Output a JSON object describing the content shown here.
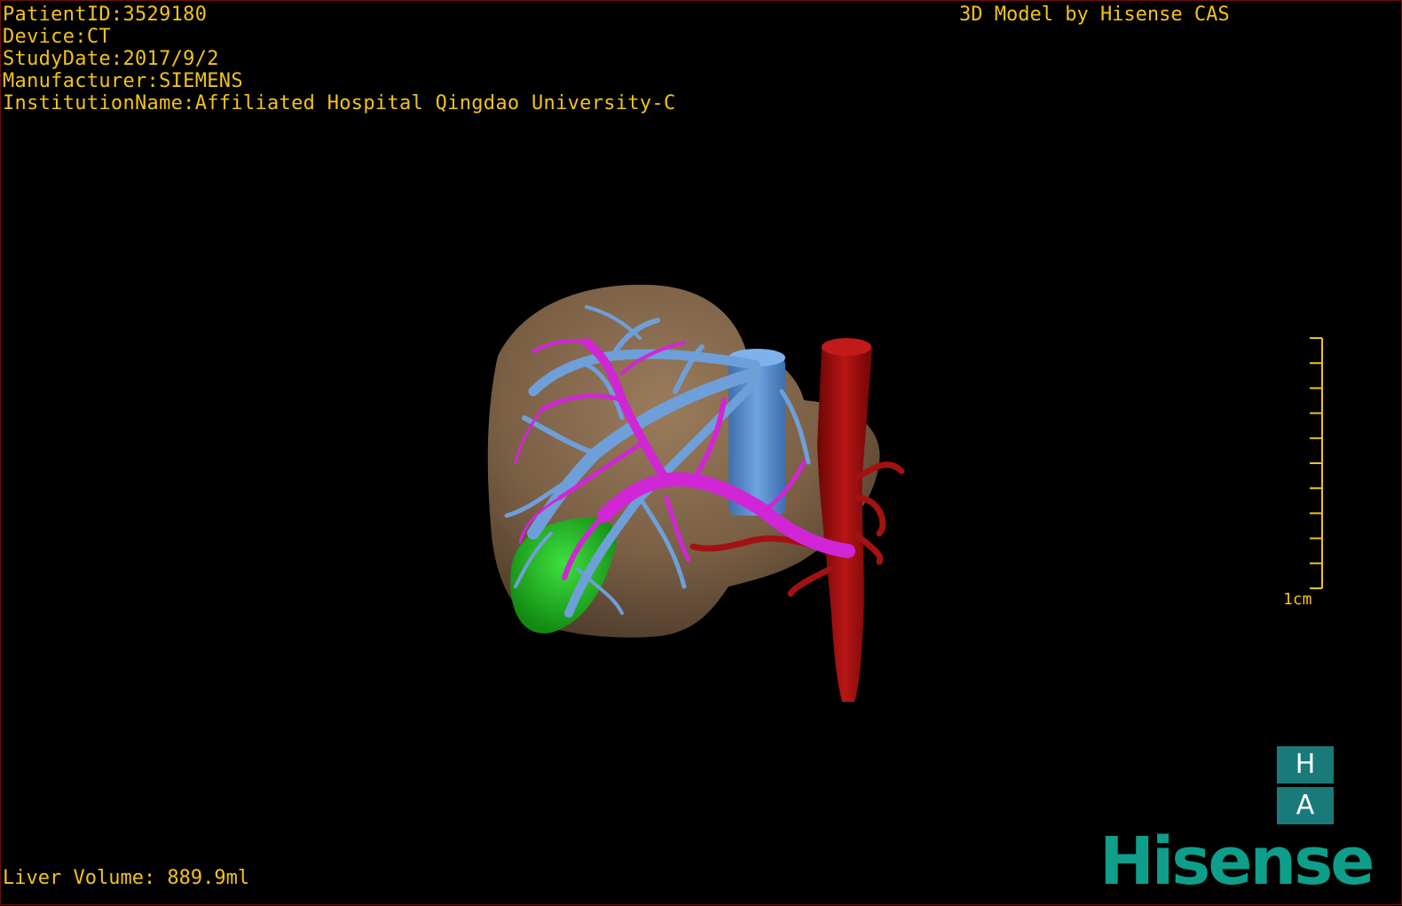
{
  "overlay": {
    "patient_id": "PatientID:3529180",
    "device": "Device:CT",
    "study_date": "StudyDate:2017/9/2",
    "manufacturer": "Manufacturer:SIEMENS",
    "institution": "InstitutionName:Affiliated Hospital Qingdao University-C",
    "watermark": "3D Model by Hisense CAS",
    "liver_volume": "Liver Volume: 889.9ml"
  },
  "scale": {
    "label": "1cm"
  },
  "orientation": {
    "top": "H",
    "bottom": "A"
  },
  "brand": {
    "logo_text": "Hisense"
  },
  "colors": {
    "text": "#f2c21c",
    "liver": "#7a5f45",
    "hepatic_vein": "#6f9fd8",
    "portal_vein": "#d026d6",
    "ivc": "#5b8ccf",
    "aorta": "#a01010",
    "gallbladder": "#25b425",
    "orientation_box": "#1a7a7a",
    "logo": "#0e9e8a"
  }
}
